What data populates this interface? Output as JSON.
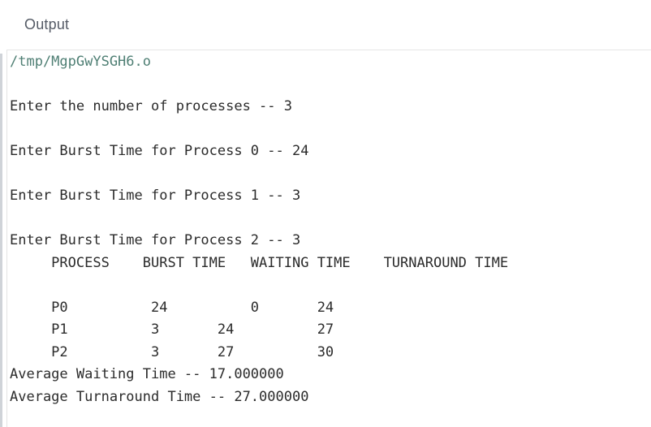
{
  "panel": {
    "title": "Output"
  },
  "console": {
    "lines": [
      {
        "text": "/tmp/MgpGwYSGH6.o"
      },
      {
        "text": "Enter the number of processes -- 3"
      },
      {
        "text": "Enter Burst Time for Process 0 -- 24"
      },
      {
        "text": "Enter Burst Time for Process 1 -- 3"
      },
      {
        "text": "Enter Burst Time for Process 2 -- 3"
      },
      {
        "text": "     PROCESS    BURST TIME   WAITING TIME    TURNAROUND TIME"
      },
      {
        "text": "     P0          24          0       24"
      },
      {
        "text": "     P1          3       24          27"
      },
      {
        "text": "     P2          3       27          30"
      },
      {
        "text": "Average Waiting Time -- 17.000000"
      },
      {
        "text": "Average Turnaround Time -- 27.000000"
      }
    ]
  }
}
